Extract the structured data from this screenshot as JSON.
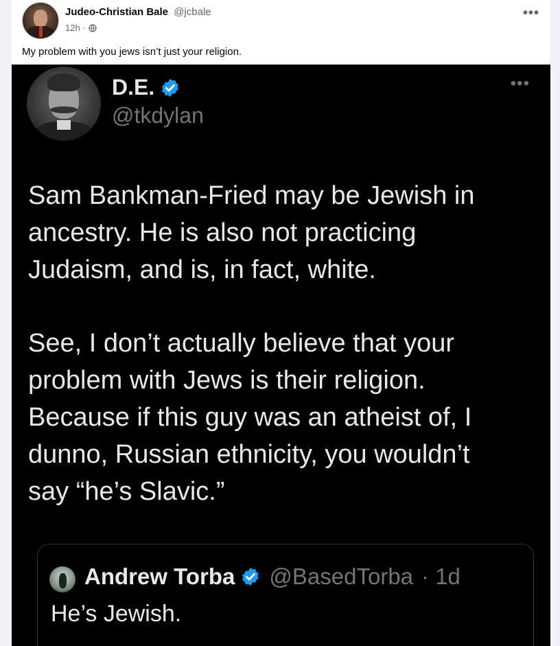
{
  "post": {
    "author_name": "Judeo-Christian Bale",
    "author_handle": "@jcbale",
    "timestamp": "12h",
    "separator": "·",
    "privacy_icon": "globe-icon",
    "more_label": "•••",
    "text": "My problem with you jews isn’t just your religion."
  },
  "tweet": {
    "name": "D.E.",
    "handle": "@tkdylan",
    "more_label": "•••",
    "paragraph1": [
      "Sam Bankman-Fried may be Jewish in",
      "ancestry. He is also not practicing",
      "Judaism, and is, in fact, white."
    ],
    "paragraph2": [
      "See, I don’t actually believe that your",
      "problem with Jews is their religion.",
      "Because if this guy was an atheist of, I",
      "dunno, Russian ethnicity, you wouldn’t",
      "say “he’s Slavic.”"
    ],
    "verified_color": "#1d9bf0"
  },
  "quoted": {
    "name": "Andrew Torba",
    "handle": "@BasedTorba",
    "time": "· 1d",
    "text": "He’s Jewish."
  },
  "colors": {
    "page_bg": "#f0f2f5",
    "card_bg": "#ffffff",
    "tweet_bg": "#000000",
    "tweet_text": "#e7e9ea",
    "tweet_muted": "#71767b"
  }
}
